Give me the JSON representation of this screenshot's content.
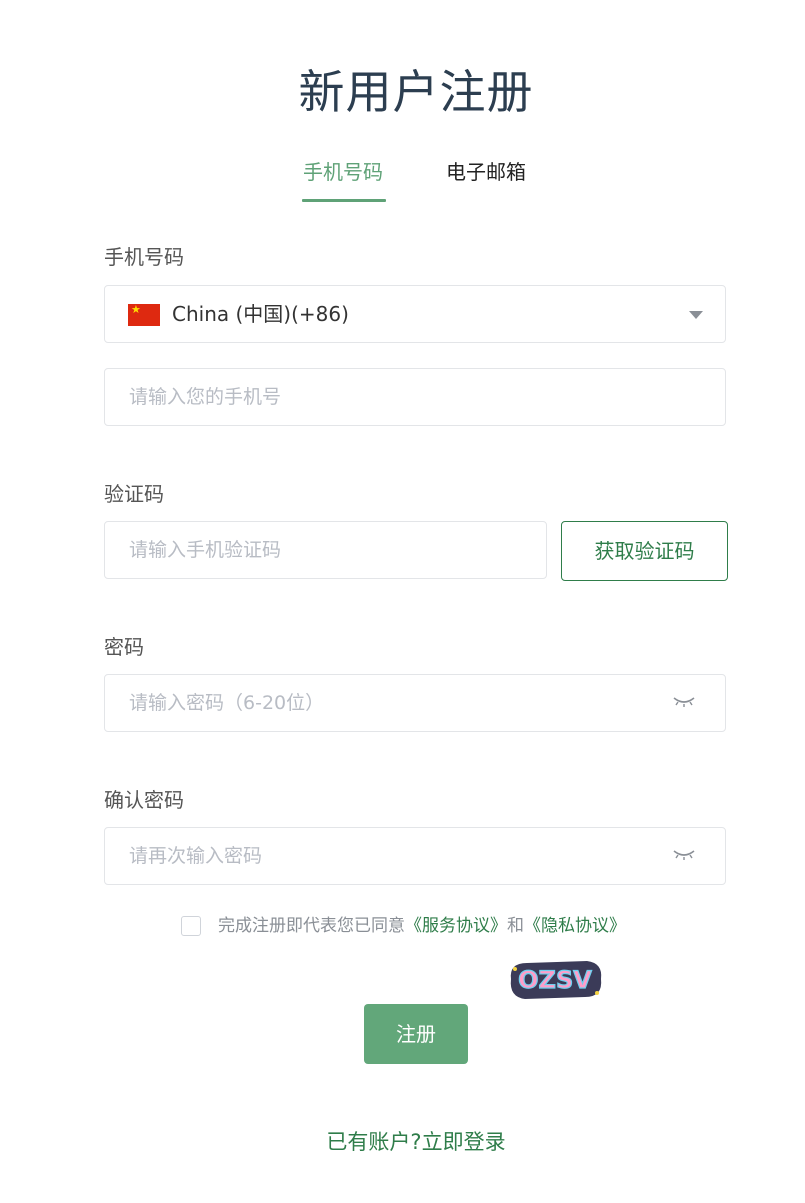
{
  "title": "新用户注册",
  "tabs": [
    {
      "label": "手机号码",
      "active": true
    },
    {
      "label": "电子邮箱",
      "active": false
    }
  ],
  "phone": {
    "label": "手机号码",
    "country": "China (中国)(+86)",
    "country_icon": "cn-flag-icon",
    "placeholder": "请输入您的手机号"
  },
  "code": {
    "label": "验证码",
    "placeholder": "请输入手机验证码",
    "button": "获取验证码"
  },
  "password": {
    "label": "密码",
    "placeholder": "请输入密码（6-20位）"
  },
  "confirm": {
    "label": "确认密码",
    "placeholder": "请再次输入密码"
  },
  "agree": {
    "prefix": "完成注册即代表您已同意",
    "service": "《服务协议》",
    "and": "和",
    "privacy": "《隐私协议》"
  },
  "sticker_text": "OZSV",
  "submit": "注册",
  "login_link": "已有账户?立即登录",
  "colors": {
    "accent": "#5fa277",
    "link": "#2f7d4a",
    "button_bg": "#62a77a"
  }
}
